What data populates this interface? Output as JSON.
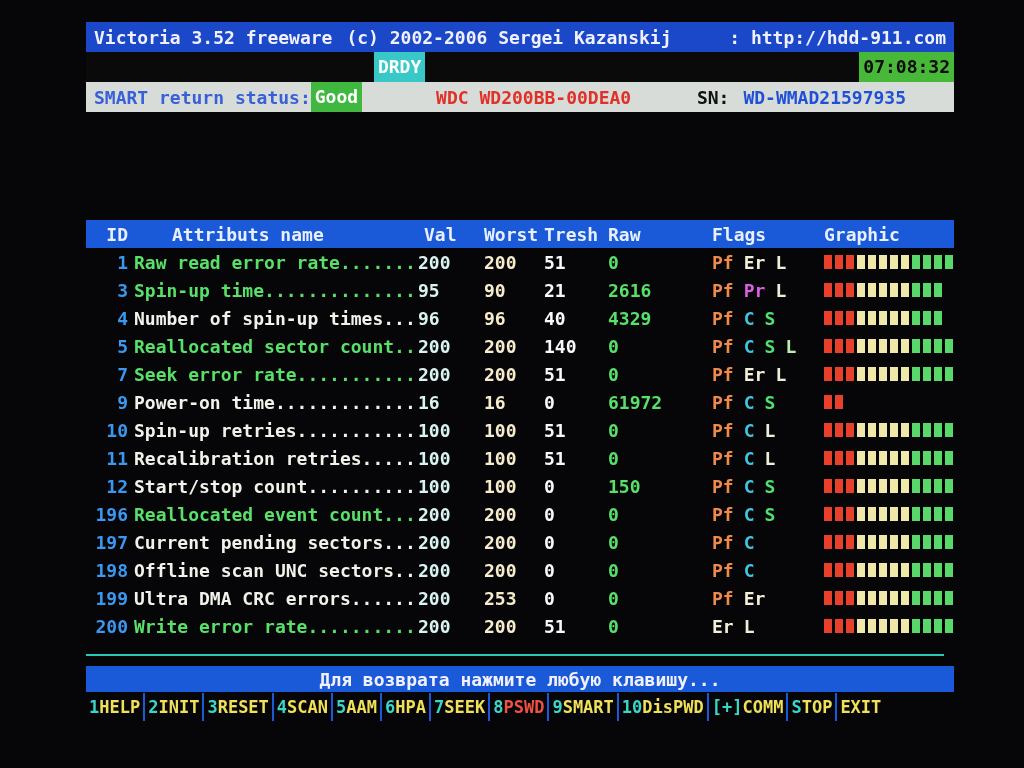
{
  "title_bar": {
    "program": "Victoria 3.52 freeware",
    "copyright": "(c) 2002-2006  Sergei Kazanskij",
    "url": ": http://hdd-911.com"
  },
  "status_row": {
    "flag": "DRDY",
    "clock": "07:08:32"
  },
  "smart_row": {
    "label": "SMART return status:",
    "status": "Good",
    "model": "WDC WD200BB-00DEA0",
    "sn_label": "SN:",
    "serial": "WD-WMAD21597935"
  },
  "table": {
    "columns": [
      "ID",
      "Attributs name",
      "Val",
      "Worst",
      "Tresh",
      "Raw",
      "Flags",
      "Graphic"
    ],
    "rows": [
      {
        "id": "1",
        "name": "Raw read error rate.......",
        "highlighted": true,
        "val": "200",
        "worst": "200",
        "tresh": "51",
        "raw": "0",
        "flags": [
          {
            "text": "Pf",
            "color": "#f08a4b"
          },
          {
            "text": "Er",
            "color": "#f4f0d8"
          },
          {
            "text": "L",
            "color": "#e8f0d8"
          }
        ],
        "graphic": [
          {
            "color": "#e8402a"
          },
          {
            "color": "#e8402a"
          },
          {
            "color": "#e8402a"
          },
          {
            "color": "#f0e8a8"
          },
          {
            "color": "#f0e8a8"
          },
          {
            "color": "#f0e8a8"
          },
          {
            "color": "#f0e8a8"
          },
          {
            "color": "#f0e8a8"
          },
          {
            "color": "#58d868"
          },
          {
            "color": "#58d868"
          },
          {
            "color": "#58d868"
          },
          {
            "color": "#58d868"
          }
        ]
      },
      {
        "id": "3",
        "name": "Spin-up time..............",
        "highlighted": true,
        "val": "95",
        "worst": "90",
        "tresh": "21",
        "raw": "2616",
        "flags": [
          {
            "text": "Pf",
            "color": "#f08a4b"
          },
          {
            "text": "Pr",
            "color": "#d860e0"
          },
          {
            "text": "L",
            "color": "#e8f0d8"
          }
        ],
        "graphic": [
          {
            "color": "#e8402a"
          },
          {
            "color": "#e8402a"
          },
          {
            "color": "#e8402a"
          },
          {
            "color": "#f0e8a8"
          },
          {
            "color": "#f0e8a8"
          },
          {
            "color": "#f0e8a8"
          },
          {
            "color": "#f0e8a8"
          },
          {
            "color": "#f0e8a8"
          },
          {
            "color": "#58d868"
          },
          {
            "color": "#58d868"
          },
          {
            "color": "#58d868"
          }
        ]
      },
      {
        "id": "4",
        "name": "Number of spin-up times...",
        "highlighted": false,
        "val": "96",
        "worst": "96",
        "tresh": "40",
        "raw": "4329",
        "flags": [
          {
            "text": "Pf",
            "color": "#f08a4b"
          },
          {
            "text": "C",
            "color": "#40c8e0"
          },
          {
            "text": "S",
            "color": "#50e070"
          }
        ],
        "graphic": [
          {
            "color": "#e8402a"
          },
          {
            "color": "#e8402a"
          },
          {
            "color": "#e8402a"
          },
          {
            "color": "#f0e8a8"
          },
          {
            "color": "#f0e8a8"
          },
          {
            "color": "#f0e8a8"
          },
          {
            "color": "#f0e8a8"
          },
          {
            "color": "#f0e8a8"
          },
          {
            "color": "#58d868"
          },
          {
            "color": "#58d868"
          },
          {
            "color": "#58d868"
          }
        ]
      },
      {
        "id": "5",
        "name": "Reallocated sector count..",
        "highlighted": true,
        "val": "200",
        "worst": "200",
        "tresh": "140",
        "raw": "0",
        "flags": [
          {
            "text": "Pf",
            "color": "#f08a4b"
          },
          {
            "text": "C",
            "color": "#40c8e0"
          },
          {
            "text": "S",
            "color": "#50e070"
          },
          {
            "text": "L",
            "color": "#b8f0b0"
          }
        ],
        "graphic": [
          {
            "color": "#e8402a"
          },
          {
            "color": "#e8402a"
          },
          {
            "color": "#e8402a"
          },
          {
            "color": "#f0e8a8"
          },
          {
            "color": "#f0e8a8"
          },
          {
            "color": "#f0e8a8"
          },
          {
            "color": "#f0e8a8"
          },
          {
            "color": "#f0e8a8"
          },
          {
            "color": "#58d868"
          },
          {
            "color": "#58d868"
          },
          {
            "color": "#58d868"
          },
          {
            "color": "#58d868"
          }
        ]
      },
      {
        "id": "7",
        "name": "Seek error rate...........",
        "highlighted": true,
        "val": "200",
        "worst": "200",
        "tresh": "51",
        "raw": "0",
        "flags": [
          {
            "text": "Pf",
            "color": "#f08a4b"
          },
          {
            "text": "Er",
            "color": "#f4f0d8"
          },
          {
            "text": "L",
            "color": "#e8f0d8"
          }
        ],
        "graphic": [
          {
            "color": "#e8402a"
          },
          {
            "color": "#e8402a"
          },
          {
            "color": "#e8402a"
          },
          {
            "color": "#f0e8a8"
          },
          {
            "color": "#f0e8a8"
          },
          {
            "color": "#f0e8a8"
          },
          {
            "color": "#f0e8a8"
          },
          {
            "color": "#f0e8a8"
          },
          {
            "color": "#58d868"
          },
          {
            "color": "#58d868"
          },
          {
            "color": "#58d868"
          },
          {
            "color": "#58d868"
          }
        ]
      },
      {
        "id": "9",
        "name": "Power-on time.............",
        "highlighted": false,
        "val": "16",
        "worst": "16",
        "tresh": "0",
        "raw": "61972",
        "flags": [
          {
            "text": "Pf",
            "color": "#f08a4b"
          },
          {
            "text": "C",
            "color": "#40c8e0"
          },
          {
            "text": "S",
            "color": "#50e070"
          }
        ],
        "graphic": [
          {
            "color": "#e8402a"
          },
          {
            "color": "#e8402a"
          }
        ]
      },
      {
        "id": "10",
        "name": "Spin-up retries...........",
        "highlighted": false,
        "val": "100",
        "worst": "100",
        "tresh": "51",
        "raw": "0",
        "flags": [
          {
            "text": "Pf",
            "color": "#f08a4b"
          },
          {
            "text": "C",
            "color": "#40c8e0"
          },
          {
            "text": "L",
            "color": "#e8f0d8"
          }
        ],
        "graphic": [
          {
            "color": "#e8402a"
          },
          {
            "color": "#e8402a"
          },
          {
            "color": "#e8402a"
          },
          {
            "color": "#f0e8a8"
          },
          {
            "color": "#f0e8a8"
          },
          {
            "color": "#f0e8a8"
          },
          {
            "color": "#f0e8a8"
          },
          {
            "color": "#f0e8a8"
          },
          {
            "color": "#58d868"
          },
          {
            "color": "#58d868"
          },
          {
            "color": "#58d868"
          },
          {
            "color": "#58d868"
          }
        ]
      },
      {
        "id": "11",
        "name": "Recalibration retries.....",
        "highlighted": false,
        "val": "100",
        "worst": "100",
        "tresh": "51",
        "raw": "0",
        "flags": [
          {
            "text": "Pf",
            "color": "#f08a4b"
          },
          {
            "text": "C",
            "color": "#40c8e0"
          },
          {
            "text": "L",
            "color": "#e8f0d8"
          }
        ],
        "graphic": [
          {
            "color": "#e8402a"
          },
          {
            "color": "#e8402a"
          },
          {
            "color": "#e8402a"
          },
          {
            "color": "#f0e8a8"
          },
          {
            "color": "#f0e8a8"
          },
          {
            "color": "#f0e8a8"
          },
          {
            "color": "#f0e8a8"
          },
          {
            "color": "#f0e8a8"
          },
          {
            "color": "#58d868"
          },
          {
            "color": "#58d868"
          },
          {
            "color": "#58d868"
          },
          {
            "color": "#58d868"
          }
        ]
      },
      {
        "id": "12",
        "name": "Start/stop count..........",
        "highlighted": false,
        "val": "100",
        "worst": "100",
        "tresh": "0",
        "raw": "150",
        "flags": [
          {
            "text": "Pf",
            "color": "#f08a4b"
          },
          {
            "text": "C",
            "color": "#40c8e0"
          },
          {
            "text": "S",
            "color": "#50e070"
          }
        ],
        "graphic": [
          {
            "color": "#e8402a"
          },
          {
            "color": "#e8402a"
          },
          {
            "color": "#e8402a"
          },
          {
            "color": "#f0e8a8"
          },
          {
            "color": "#f0e8a8"
          },
          {
            "color": "#f0e8a8"
          },
          {
            "color": "#f0e8a8"
          },
          {
            "color": "#f0e8a8"
          },
          {
            "color": "#58d868"
          },
          {
            "color": "#58d868"
          },
          {
            "color": "#58d868"
          },
          {
            "color": "#58d868"
          }
        ]
      },
      {
        "id": "196",
        "name": "Reallocated event count...",
        "highlighted": true,
        "val": "200",
        "worst": "200",
        "tresh": "0",
        "raw": "0",
        "flags": [
          {
            "text": "Pf",
            "color": "#f08a4b"
          },
          {
            "text": "C",
            "color": "#40c8e0"
          },
          {
            "text": "S",
            "color": "#50e070"
          }
        ],
        "graphic": [
          {
            "color": "#e8402a"
          },
          {
            "color": "#e8402a"
          },
          {
            "color": "#e8402a"
          },
          {
            "color": "#f0e8a8"
          },
          {
            "color": "#f0e8a8"
          },
          {
            "color": "#f0e8a8"
          },
          {
            "color": "#f0e8a8"
          },
          {
            "color": "#f0e8a8"
          },
          {
            "color": "#58d868"
          },
          {
            "color": "#58d868"
          },
          {
            "color": "#58d868"
          },
          {
            "color": "#58d868"
          }
        ]
      },
      {
        "id": "197",
        "name": "Current pending sectors...",
        "highlighted": false,
        "val": "200",
        "worst": "200",
        "tresh": "0",
        "raw": "0",
        "flags": [
          {
            "text": "Pf",
            "color": "#f08a4b"
          },
          {
            "text": "C",
            "color": "#40c8e0"
          }
        ],
        "graphic": [
          {
            "color": "#e8402a"
          },
          {
            "color": "#e8402a"
          },
          {
            "color": "#e8402a"
          },
          {
            "color": "#f0e8a8"
          },
          {
            "color": "#f0e8a8"
          },
          {
            "color": "#f0e8a8"
          },
          {
            "color": "#f0e8a8"
          },
          {
            "color": "#f0e8a8"
          },
          {
            "color": "#58d868"
          },
          {
            "color": "#58d868"
          },
          {
            "color": "#58d868"
          },
          {
            "color": "#58d868"
          }
        ]
      },
      {
        "id": "198",
        "name": "Offline scan UNC sectors..",
        "highlighted": false,
        "val": "200",
        "worst": "200",
        "tresh": "0",
        "raw": "0",
        "flags": [
          {
            "text": "Pf",
            "color": "#f08a4b"
          },
          {
            "text": "C",
            "color": "#40c8e0"
          }
        ],
        "graphic": [
          {
            "color": "#e8402a"
          },
          {
            "color": "#e8402a"
          },
          {
            "color": "#e8402a"
          },
          {
            "color": "#f0e8a8"
          },
          {
            "color": "#f0e8a8"
          },
          {
            "color": "#f0e8a8"
          },
          {
            "color": "#f0e8a8"
          },
          {
            "color": "#f0e8a8"
          },
          {
            "color": "#58d868"
          },
          {
            "color": "#58d868"
          },
          {
            "color": "#58d868"
          },
          {
            "color": "#58d868"
          }
        ]
      },
      {
        "id": "199",
        "name": "Ultra DMA CRC errors......",
        "highlighted": false,
        "val": "200",
        "worst": "253",
        "tresh": "0",
        "raw": "0",
        "flags": [
          {
            "text": "Pf",
            "color": "#f08a4b"
          },
          {
            "text": "Er",
            "color": "#f4f0d8"
          }
        ],
        "graphic": [
          {
            "color": "#e8402a"
          },
          {
            "color": "#e8402a"
          },
          {
            "color": "#e8402a"
          },
          {
            "color": "#f0e8a8"
          },
          {
            "color": "#f0e8a8"
          },
          {
            "color": "#f0e8a8"
          },
          {
            "color": "#f0e8a8"
          },
          {
            "color": "#f0e8a8"
          },
          {
            "color": "#58d868"
          },
          {
            "color": "#58d868"
          },
          {
            "color": "#58d868"
          },
          {
            "color": "#58d868"
          }
        ]
      },
      {
        "id": "200",
        "name": "Write error rate..........",
        "highlighted": true,
        "val": "200",
        "worst": "200",
        "tresh": "51",
        "raw": "0",
        "flags": [
          {
            "text": "Er",
            "color": "#f4f0d8"
          },
          {
            "text": "L",
            "color": "#e8f0d8"
          }
        ],
        "graphic": [
          {
            "color": "#e8402a"
          },
          {
            "color": "#e8402a"
          },
          {
            "color": "#e8402a"
          },
          {
            "color": "#f0e8a8"
          },
          {
            "color": "#f0e8a8"
          },
          {
            "color": "#f0e8a8"
          },
          {
            "color": "#f0e8a8"
          },
          {
            "color": "#f0e8a8"
          },
          {
            "color": "#58d868"
          },
          {
            "color": "#58d868"
          },
          {
            "color": "#58d868"
          },
          {
            "color": "#58d868"
          }
        ]
      }
    ]
  },
  "message": "Для возврата нажмите любую клавишу...",
  "function_keys": [
    {
      "hot": "1",
      "label": "HELP",
      "alert": false
    },
    {
      "hot": "2",
      "label": "INIT",
      "alert": false
    },
    {
      "hot": "3",
      "label": "RESET",
      "alert": false
    },
    {
      "hot": "4",
      "label": "SCAN",
      "alert": false
    },
    {
      "hot": "5",
      "label": "AAM",
      "alert": false
    },
    {
      "hot": "6",
      "label": "HPA",
      "alert": false
    },
    {
      "hot": "7",
      "label": "SEEK",
      "alert": false
    },
    {
      "hot": "8",
      "label": "PSWD",
      "alert": true
    },
    {
      "hot": "9",
      "label": "SMART",
      "alert": false
    },
    {
      "hot": "10",
      "label": "DisPWD",
      "alert": false
    },
    {
      "hot": "[+]",
      "label": "COMM",
      "alert": false
    },
    {
      "hot": "S",
      "label": "TOP",
      "alert": false
    },
    {
      "label": "EXIT",
      "alert": false
    }
  ]
}
